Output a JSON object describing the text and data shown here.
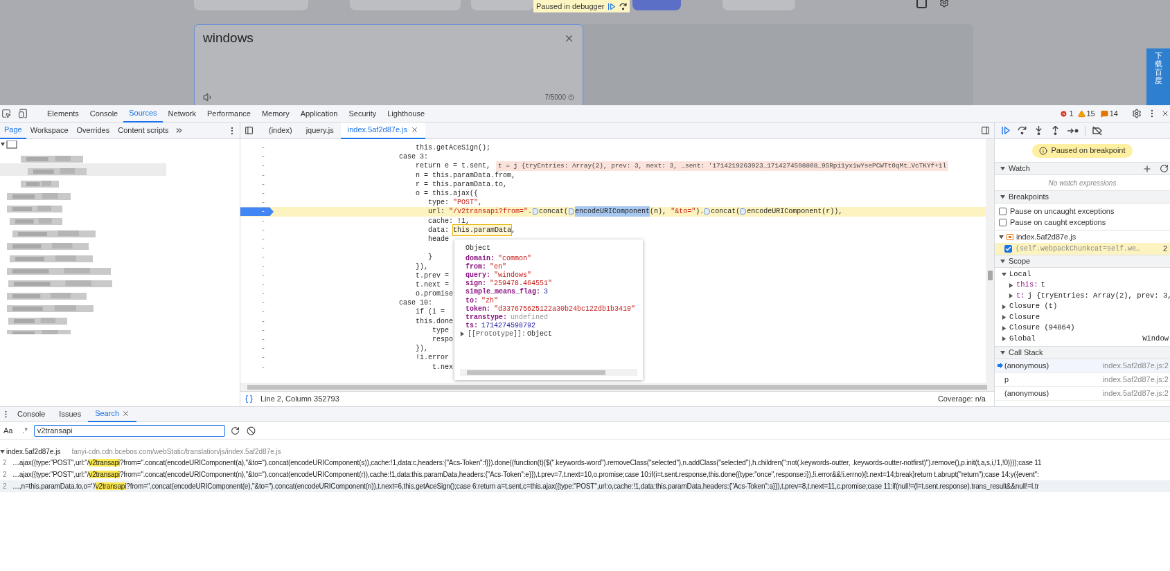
{
  "page": {
    "debugger_banner": "Paused in debugger",
    "input_text": "windows",
    "char_count": "7/5000",
    "side_tab": "下载百度"
  },
  "devtools": {
    "tabs": [
      {
        "label": "Elements",
        "selected": false
      },
      {
        "label": "Console",
        "selected": false
      },
      {
        "label": "Sources",
        "selected": true
      },
      {
        "label": "Network",
        "selected": false
      },
      {
        "label": "Performance",
        "selected": false
      },
      {
        "label": "Memory",
        "selected": false
      },
      {
        "label": "Application",
        "selected": false
      },
      {
        "label": "Security",
        "selected": false
      },
      {
        "label": "Lighthouse",
        "selected": false
      }
    ],
    "errors": "1",
    "warnings": "15",
    "issues": "14"
  },
  "navigator": {
    "tabs": [
      {
        "label": "Page",
        "selected": true
      },
      {
        "label": "Workspace",
        "selected": false
      },
      {
        "label": "Overrides",
        "selected": false
      },
      {
        "label": "Content scripts",
        "selected": false
      }
    ]
  },
  "editor": {
    "tabs": [
      {
        "label": "(index)",
        "selected": false,
        "closable": false
      },
      {
        "label": "jquery.js",
        "selected": false,
        "closable": false
      },
      {
        "label": "index.5af2d87e.js",
        "selected": true,
        "closable": true
      }
    ],
    "lines": [
      {
        "number": "-",
        "paused": false,
        "text": "    this.getAceSign();"
      },
      {
        "number": "-",
        "paused": false,
        "text": "case 3:"
      },
      {
        "number": "-",
        "paused": false,
        "text": "    return e = t.sent,",
        "inline_value": "t = j {tryEntries: Array(2), prev: 3, next: 3, _sent: '1714219263923_1714274598808_9SRpi1yx1wYsePCWTt0qMt…VcTKYf+1l"
      },
      {
        "number": "-",
        "paused": false,
        "text": "    n = this.paramData.from,"
      },
      {
        "number": "-",
        "paused": false,
        "text": "    r = this.paramData.to,"
      },
      {
        "number": "-",
        "paused": false,
        "text": "    o = this.ajax({"
      },
      {
        "number": "-",
        "paused": false,
        "text": "       type: \"POST\","
      },
      {
        "number": "-",
        "paused": true,
        "parts": [
          {
            "kind": "code",
            "text": "       url: \"/v2transapi?from=\"."
          },
          {
            "kind": "marker"
          },
          {
            "kind": "code",
            "text": "concat("
          },
          {
            "kind": "marker"
          },
          {
            "kind": "selection",
            "text": "encodeURIComponent"
          },
          {
            "kind": "code",
            "text": "(n), \"&to=\")."
          },
          {
            "kind": "marker"
          },
          {
            "kind": "code",
            "text": "concat("
          },
          {
            "kind": "marker"
          },
          {
            "kind": "code",
            "text": "encodeURIComponent(r)),"
          }
        ]
      },
      {
        "number": "-",
        "paused": false,
        "text": "       cache: !1,"
      },
      {
        "number": "-",
        "paused": false,
        "parts": [
          {
            "kind": "code",
            "text": "       data: "
          },
          {
            "kind": "hover",
            "text": "this.paramData"
          },
          {
            "kind": "code",
            "text": ","
          }
        ]
      },
      {
        "number": "-",
        "paused": false,
        "text": "       heade"
      },
      {
        "number": "-",
        "paused": false
      },
      {
        "number": "-",
        "paused": false,
        "text": "       }"
      },
      {
        "number": "-",
        "paused": false,
        "text": "    }),"
      },
      {
        "number": "-",
        "paused": false,
        "text": "    t.prev ="
      },
      {
        "number": "-",
        "paused": false,
        "text": "    t.next ="
      },
      {
        "number": "-",
        "paused": false,
        "text": "    o.promise"
      },
      {
        "number": "-",
        "paused": false,
        "text": "case 10:"
      },
      {
        "number": "-",
        "paused": false,
        "text": "    if (i ="
      },
      {
        "number": "-",
        "paused": false,
        "text": "    this.done"
      },
      {
        "number": "-",
        "paused": false,
        "text": "        type"
      },
      {
        "number": "-",
        "paused": false,
        "text": "        respo"
      },
      {
        "number": "-",
        "paused": false,
        "text": "    }),"
      },
      {
        "number": "-",
        "paused": false,
        "text": "    !i.error"
      },
      {
        "number": "-",
        "paused": false,
        "text": "        t.nex"
      }
    ],
    "popover": {
      "title": "Object",
      "properties": [
        {
          "key": "domain:",
          "value": "\"common\"",
          "kind": "string"
        },
        {
          "key": "from:",
          "value": "\"en\"",
          "kind": "string"
        },
        {
          "key": "query:",
          "value": "\"windows\"",
          "kind": "string"
        },
        {
          "key": "sign:",
          "value": "\"259478.464551\"",
          "kind": "string"
        },
        {
          "key": "simple_means_flag:",
          "value": "3",
          "kind": "number"
        },
        {
          "key": "to:",
          "value": "\"zh\"",
          "kind": "string"
        },
        {
          "key": "token:",
          "value": "\"d337675625122a30b24bc122db1b3410\"",
          "kind": "string"
        },
        {
          "key": "transtype:",
          "value": "undefined",
          "kind": "undefined"
        },
        {
          "key": "ts:",
          "value": "1714274598792",
          "kind": "number"
        }
      ],
      "prototype": {
        "key": "[[Prototype]]:",
        "value": "Object",
        "expanded": false
      }
    },
    "status": {
      "position": "Line 2, Column 352793",
      "coverage": "Coverage: n/a"
    }
  },
  "debugger": {
    "banner": "Paused on breakpoint",
    "watch": {
      "title": "Watch",
      "expanded": true,
      "empty": "No watch expressions"
    },
    "breakpoints": {
      "title": "Breakpoints",
      "expanded": true,
      "options": [
        {
          "label": "Pause on uncaught exceptions",
          "checked": false
        },
        {
          "label": "Pause on caught exceptions",
          "checked": false
        }
      ],
      "file": {
        "name": "index.5af2d87e.js",
        "expanded": true,
        "items": [
          {
            "code": "(self.webpackChunkcat=self.we…",
            "line": "2",
            "checked": true
          }
        ]
      }
    },
    "scope": {
      "title": "Scope",
      "expanded": true,
      "items": [
        {
          "label": "Local",
          "expanded": true,
          "children": [
            {
              "label": "this:",
              "value": "t",
              "expanded": false
            },
            {
              "label": "t:",
              "value": "j {tryEntries: Array(2), prev: 3,",
              "expanded": false
            }
          ]
        },
        {
          "label": "Closure (t)",
          "expanded": false
        },
        {
          "label": "Closure",
          "expanded": false
        },
        {
          "label": "Closure (94864)",
          "expanded": false
        },
        {
          "label": "Global",
          "value": "Window",
          "expanded": false
        }
      ]
    },
    "call_stack": {
      "title": "Call Stack",
      "expanded": true,
      "frames": [
        {
          "name": "(anonymous)",
          "location": "index.5af2d87e.js:2",
          "selected": true
        },
        {
          "name": "p",
          "location": "index.5af2d87e.js:2",
          "selected": false
        },
        {
          "name": "(anonymous)",
          "location": "index.5af2d87e.js:2",
          "selected": false
        }
      ]
    }
  },
  "drawer": {
    "tabs": [
      {
        "label": "Console",
        "selected": false,
        "closable": false
      },
      {
        "label": "Issues",
        "selected": false,
        "closable": false
      },
      {
        "label": "Search",
        "selected": true,
        "closable": true
      }
    ],
    "match_case": "Aa",
    "regex": ".*",
    "query": "v2transapi",
    "results": {
      "file": "index.5af2d87e.js",
      "url": "fanyi-cdn.cdn.bcebos.com/webStatic/translation/js/index.5af2d87e.js",
      "expanded": true,
      "matches": [
        {
          "line": "2",
          "before": "…ajax({type:\"POST\",url:\"/",
          "match": "v2transapi",
          "after": "?from=\".concat(encodeURIComponent(a),\"&to=\").concat(encodeURIComponent(s)),cache:!1,data:c,headers:{\"Acs-Token\":f}}).done((function(t){$(\".keywords-word\").removeClass(\"selected\"),n.addClass(\"selected\"),h.children(\":not(.keywords-outter, .keywords-outter-notfirst)\").remove(),p.init(t,a,s,i,!1,!0)}));case 11",
          "selected": false
        },
        {
          "line": "2",
          "before": "…ajax({type:\"POST\",url:\"/",
          "match": "v2transapi",
          "after": "?from=\".concat(encodeURIComponent(n),\"&to=\").concat(encodeURIComponent(r)),cache:!1,data:this.paramData,headers:{\"Acs-Token\":e}}),t.prev=7,t.next=10,o.promise;case 10:if(i=t.sent.response,this.done({type:\"once\",response:i}),!i.error&&!i.errno){t.next=14;break}return t.abrupt(\"return\");case 14:y({event\":",
          "selected": false
        },
        {
          "line": "2",
          "before": "…,n=this.paramData.to,o=\"/",
          "match": "v2transapi",
          "after": "?from=\".concat(encodeURIComponent(e),\"&to=\").concat(encodeURIComponent(n)),t.next=6,this.getAceSign();case 6:return a=t.sent,c=this.ajax({type:\"POST\",url:o,cache:!1,data:this.paramData,headers:{\"Acs-Token\":a}}),t.prev=8,t.next=11,c.promise;case 11:if(null!=(l=t.sent.response).trans_result&&null!=l.tr",
          "selected": true
        }
      ]
    }
  }
}
